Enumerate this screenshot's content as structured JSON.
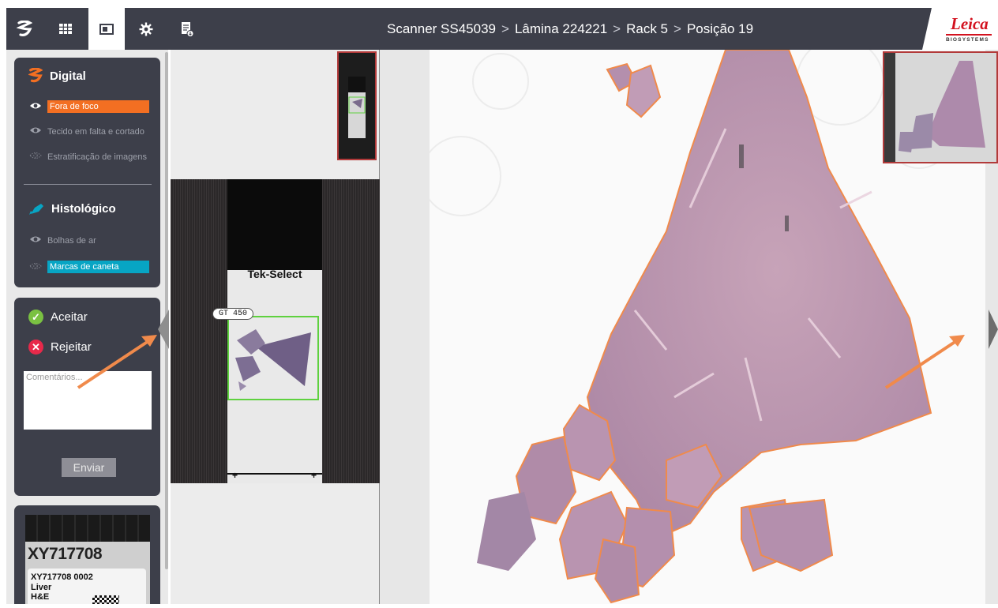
{
  "toolbar": {
    "buttons": [
      {
        "name": "digital-icon"
      },
      {
        "name": "grid-view-icon"
      },
      {
        "name": "slide-view-icon"
      },
      {
        "name": "settings-gear-icon"
      },
      {
        "name": "report-download-icon"
      }
    ],
    "active": "slide-view-icon"
  },
  "breadcrumb": {
    "scanner": "Scanner SS45039",
    "slide": "Lâmina 224221",
    "rack": "Rack 5",
    "position": "Posição 19",
    "separator": ">"
  },
  "logo": {
    "word": "Leica",
    "sub": "BIOSYSTEMS"
  },
  "quality": {
    "digital": {
      "title": "Digital",
      "items": [
        {
          "label": "Fora de foco",
          "state": "highlighted"
        },
        {
          "label": "Tecido em falta e cortado",
          "state": "normal"
        },
        {
          "label": "Estratificação de imagens",
          "state": "dashed"
        }
      ]
    },
    "histologic": {
      "title": "Histológico",
      "items": [
        {
          "label": "Bolhas de ar",
          "state": "normal"
        },
        {
          "label": "Marcas de caneta",
          "state": "highlighted"
        }
      ]
    }
  },
  "review": {
    "accept": "Aceitar",
    "reject": "Rejeitar",
    "comment_placeholder": "Comentários...",
    "submit": "Enviar"
  },
  "label_image": {
    "code": "XY717708",
    "line1": "XY717708 0002",
    "line2": "Liver",
    "line3": "H&E"
  },
  "macro": {
    "slide_brand": "Tek-Select",
    "gt_label": "GT 450"
  },
  "colors": {
    "header": "#3d3f4a",
    "focus_tag": "#f36f22",
    "pen_tag": "#07a5c4",
    "accept": "#7ac142",
    "reject": "#e8294a",
    "annotation": "#f08a4b",
    "macro_box": "#5fd13f"
  }
}
